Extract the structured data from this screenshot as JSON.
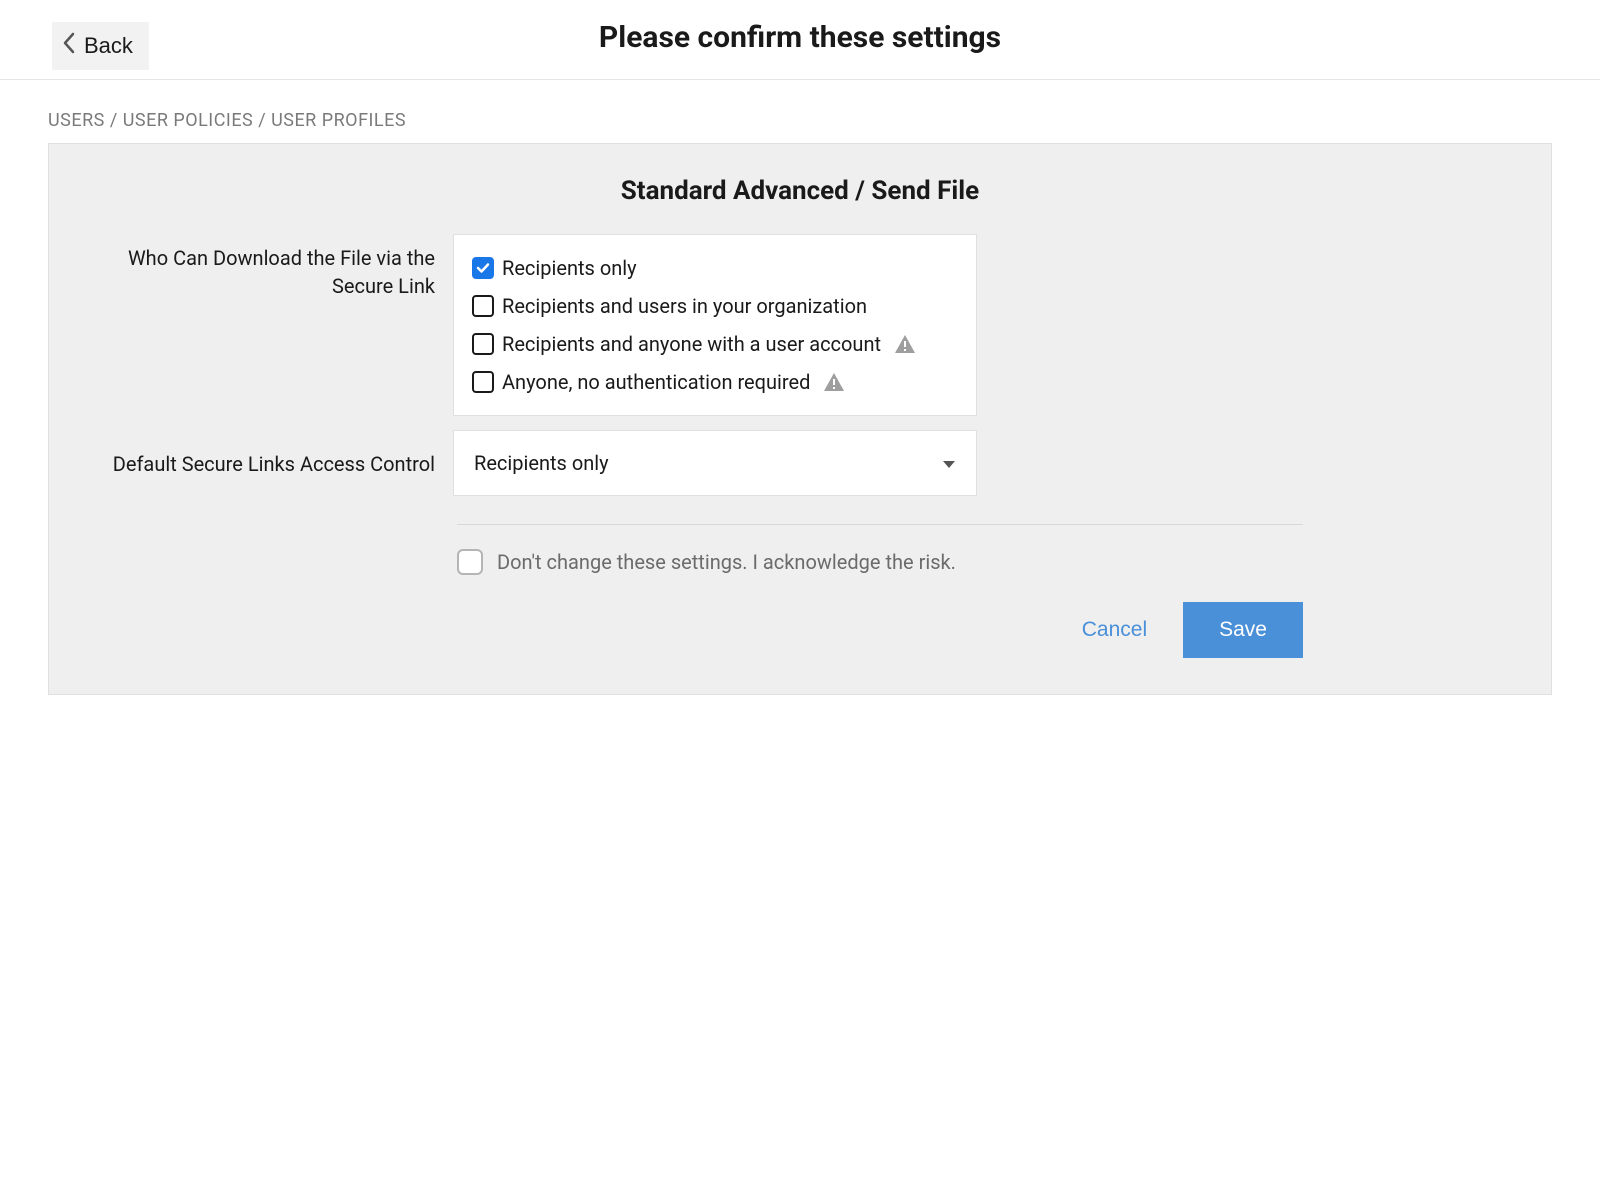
{
  "header": {
    "back_label": "Back",
    "title": "Please confirm these settings"
  },
  "breadcrumb": "USERS / USER POLICIES / USER PROFILES",
  "panel": {
    "title": "Standard Advanced / Send File",
    "download_section": {
      "label": "Who Can Download the File via the Secure Link",
      "options": [
        {
          "label": "Recipients only",
          "checked": true,
          "warning": false
        },
        {
          "label": "Recipients and users in your organization",
          "checked": false,
          "warning": false
        },
        {
          "label": "Recipients and anyone with a user account",
          "checked": false,
          "warning": true
        },
        {
          "label": "Anyone, no authentication required",
          "checked": false,
          "warning": true
        }
      ]
    },
    "default_access": {
      "label": "Default Secure Links Access Control",
      "selected": "Recipients only"
    },
    "acknowledge": {
      "text": "Don't change these settings. I acknowledge the risk.",
      "checked": false
    },
    "buttons": {
      "cancel": "Cancel",
      "save": "Save"
    }
  }
}
